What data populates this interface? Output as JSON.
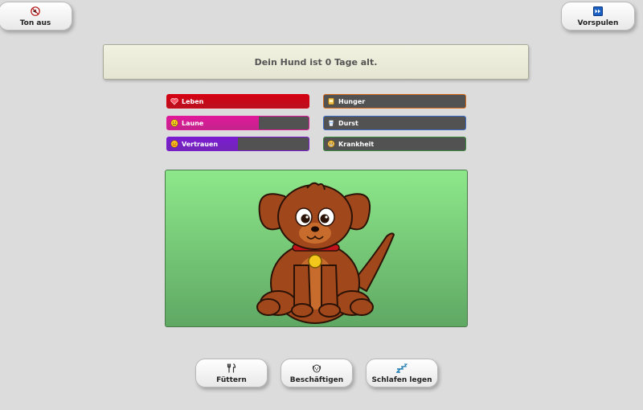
{
  "top": {
    "sound_label": "Ton aus",
    "forward_label": "Vorspulen"
  },
  "banner": {
    "text": "Dein Hund ist 0 Tage alt."
  },
  "stats": {
    "left": [
      {
        "label": "Leben",
        "icon": "heart-icon",
        "level": 1.0,
        "color": "#d40012"
      },
      {
        "label": "Laune",
        "icon": "smiley-icon",
        "level": 0.65,
        "color": "#e0189a"
      },
      {
        "label": "Vertrauen",
        "icon": "trust-icon",
        "level": 0.5,
        "color": "#7a1bd1"
      }
    ],
    "right": [
      {
        "label": "Hunger",
        "icon": "food-icon",
        "level": 0,
        "color": "#d86a1a"
      },
      {
        "label": "Durst",
        "icon": "cup-icon",
        "level": 0,
        "color": "#3b6cc8"
      },
      {
        "label": "Krankheit",
        "icon": "sick-icon",
        "level": 0,
        "color": "#3c8a3c"
      }
    ]
  },
  "actions": {
    "feed_label": "Füttern",
    "play_label": "Beschäftigen",
    "sleep_label": "Schlafen legen"
  },
  "colors": {
    "background": "#dcdcdc",
    "scene_top": "#8de88a",
    "scene_bottom": "#5fa864",
    "dog_fur": "#a0471c",
    "dog_belly": "#c86c2d",
    "collar": "#c2121b"
  }
}
